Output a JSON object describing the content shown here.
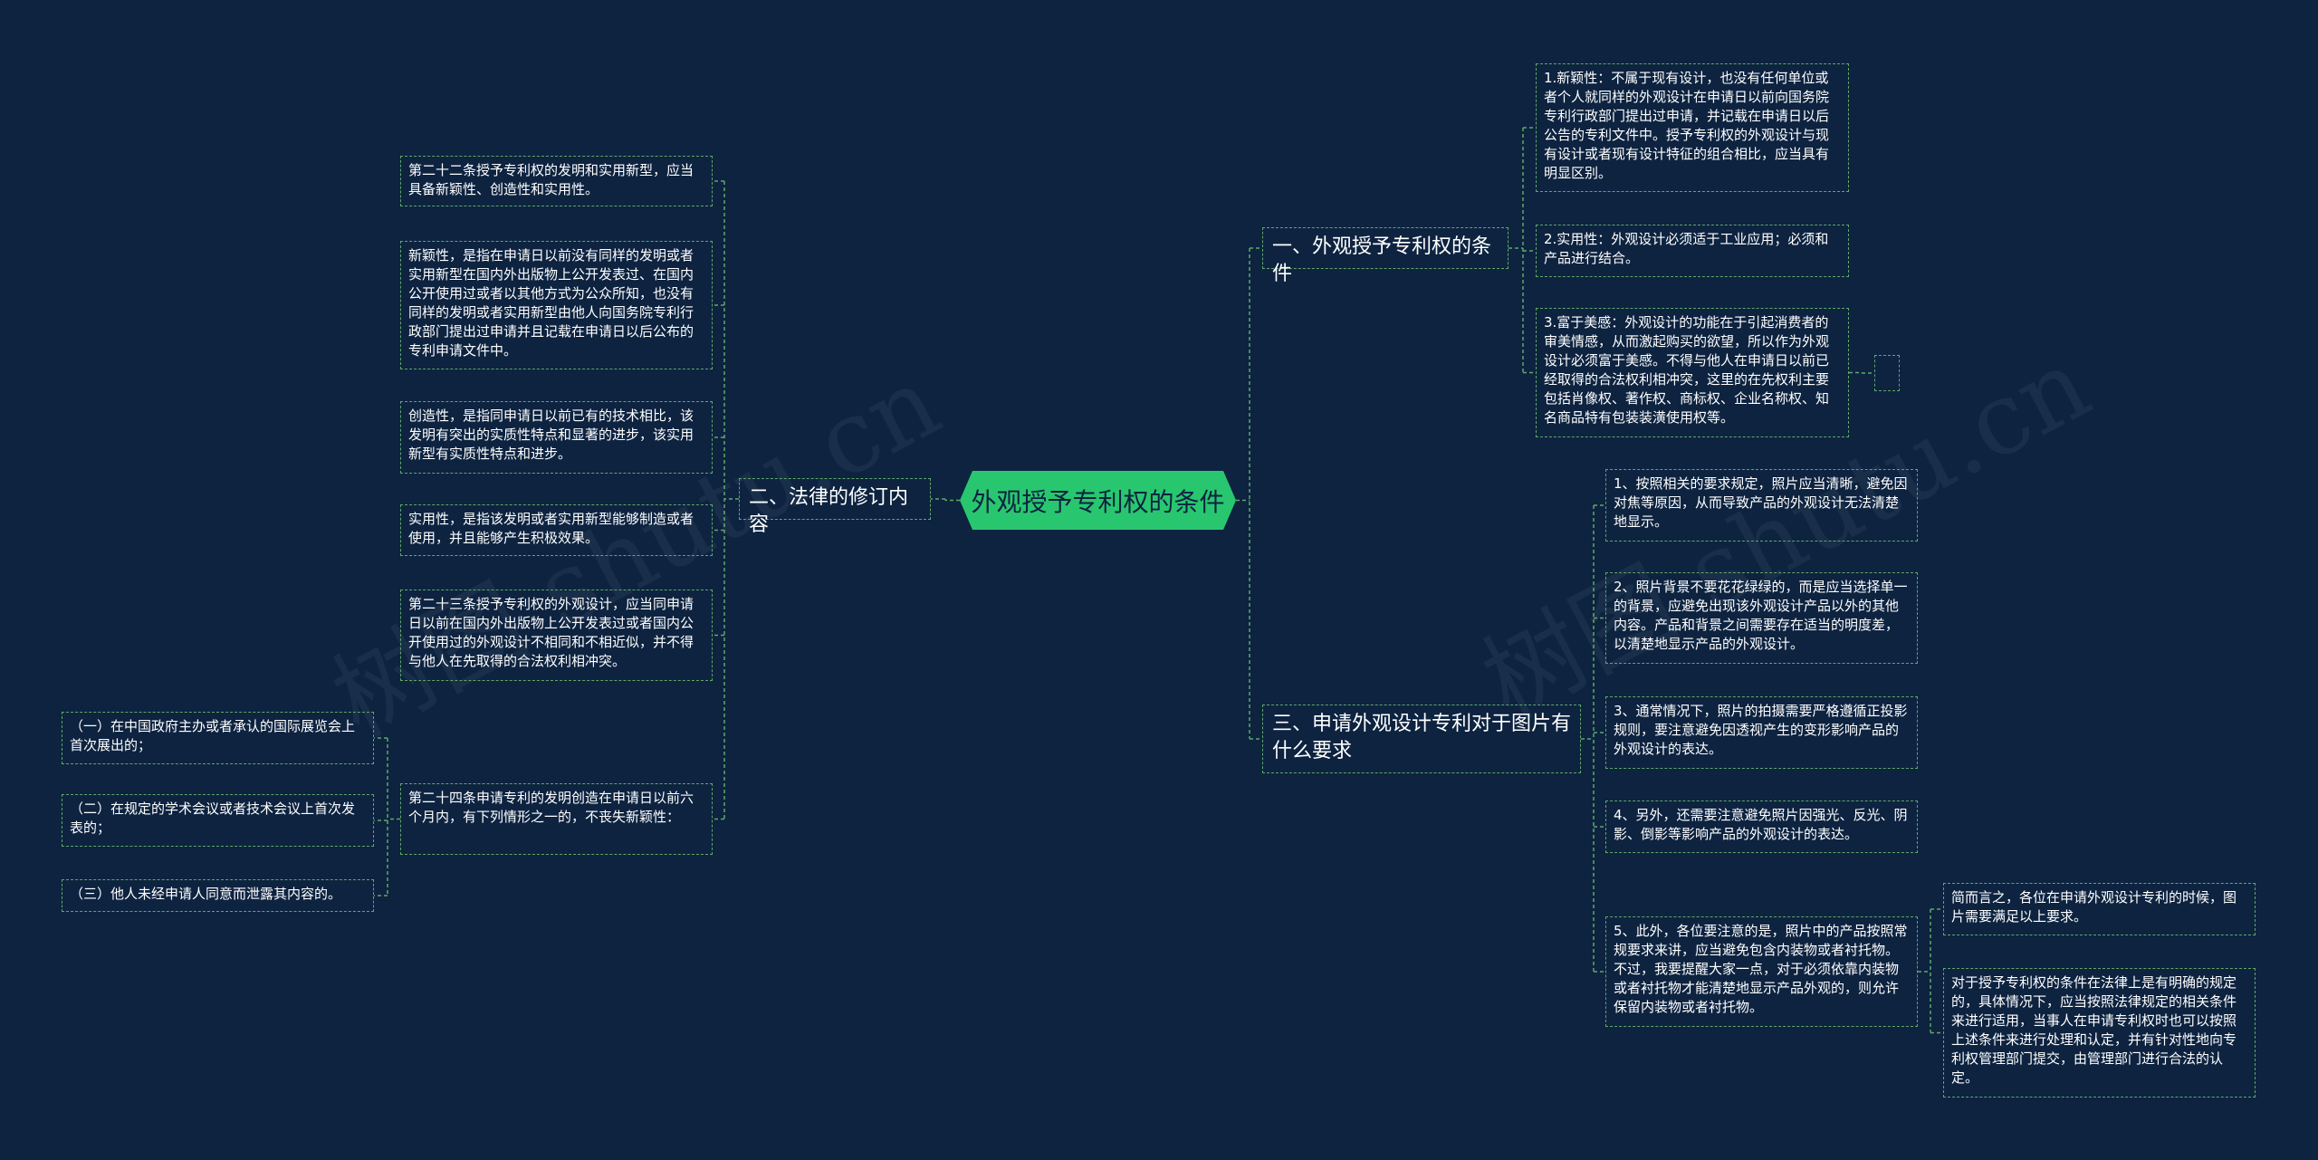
{
  "center": {
    "title": "外观授予专利权的条件"
  },
  "watermark": {
    "text": "树图 shutu.cn"
  },
  "left_branch": {
    "label": "二、法律的修订内容",
    "items": [
      "第二十二条授予专利权的发明和实用新型，应当具备新颖性、创造性和实用性。",
      "新颖性，是指在申请日以前没有同样的发明或者实用新型在国内外出版物上公开发表过、在国内公开使用过或者以其他方式为公众所知，也没有同样的发明或者实用新型由他人向国务院专利行政部门提出过申请并且记载在申请日以后公布的专利申请文件中。",
      "创造性，是指同申请日以前已有的技术相比，该发明有突出的实质性特点和显著的进步，该实用新型有实质性特点和进步。",
      "实用性，是指该发明或者实用新型能够制造或者使用，并且能够产生积极效果。",
      "第二十三条授予专利权的外观设计，应当同申请日以前在国内外出版物上公开发表过或者国内公开使用过的外观设计不相同和不相近似，并不得与他人在先取得的合法权利相冲突。",
      "第二十四条申请专利的发明创造在申请日以前六个月内，有下列情形之一的，不丧失新颖性："
    ],
    "sub_items": [
      "（一）在中国政府主办或者承认的国际展览会上首次展出的；",
      "（二）在规定的学术会议或者技术会议上首次发表的；",
      "（三）他人未经申请人同意而泄露其内容的。"
    ]
  },
  "right_branch_1": {
    "label": "一、外观授予专利权的条件",
    "items": [
      "1.新颖性：不属于现有设计，也没有任何单位或者个人就同样的外观设计在申请日以前向国务院专利行政部门提出过申请，并记载在申请日以后公告的专利文件中。授予专利权的外观设计与现有设计或者现有设计特征的组合相比，应当具有明显区别。",
      "2.实用性：外观设计必须适于工业应用；必须和产品进行结合。",
      "3.富于美感：外观设计的功能在于引起消费者的审美情感，从而激起购买的欲望，所以作为外观设计必须富于美感。不得与他人在申请日以前已经取得的合法权利相冲突，这里的在先权利主要包括肖像权、著作权、商标权、企业名称权、知名商品特有包装装潢使用权等。"
    ]
  },
  "right_branch_2": {
    "label": "三、申请外观设计专利对于图片有什么要求",
    "items": [
      "1、按照相关的要求规定，照片应当清晰，避免因对焦等原因，从而导致产品的外观设计无法清楚地显示。",
      "2、照片背景不要花花绿绿的，而是应当选择单一的背景，应避免出现该外观设计产品以外的其他内容。产品和背景之间需要存在适当的明度差，以清楚地显示产品的外观设计。",
      "3、通常情况下，照片的拍摄需要严格遵循正投影规则，要注意避免因透视产生的变形影响产品的外观设计的表达。",
      "4、另外，还需要注意避免照片因强光、反光、阴影、倒影等影响产品的外观设计的表达。",
      "5、此外，各位要注意的是，照片中的产品按照常规要求来讲，应当避免包含内装物或者衬托物。不过，我要提醒大家一点，对于必须依靠内装物或者衬托物才能清楚地显示产品外观的，则允许保留内装物或者衬托物。"
    ],
    "sub_items": [
      "简而言之，各位在申请外观设计专利的时候，图片需要满足以上要求。",
      "对于授予专利权的条件在法律上是有明确的规定的，具体情况下，应当按照法律规定的相关条件来进行适用，当事人在申请专利权时也可以按照上述条件来进行处理和认定，并有针对性地向专利权管理部门提交，由管理部门进行合法的认定。"
    ]
  },
  "colors": {
    "background": "#0d2340",
    "center": "#28c76f",
    "line": "#5fa868",
    "text": "#ffffff"
  }
}
